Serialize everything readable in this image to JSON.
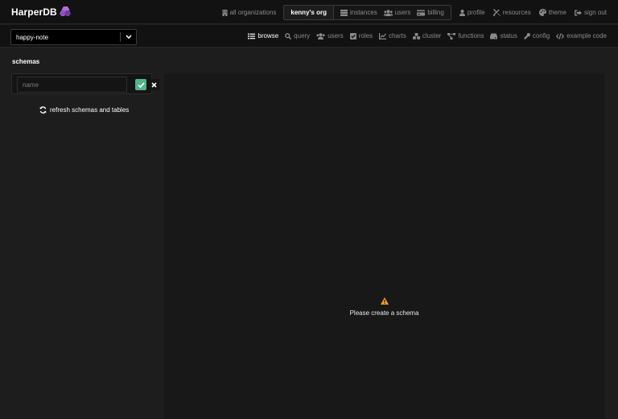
{
  "brand": {
    "name": "HarperDB",
    "logo_icon": "hexagon-logo-icon",
    "logo_colors": [
      "#b36bd6",
      "#6f3aa8"
    ]
  },
  "topnav": {
    "all_orgs": {
      "label": "all organizations",
      "icon": "building-icon"
    },
    "current_org": "kenny's org",
    "org_items": [
      {
        "label": "instances",
        "icon": "server-icon"
      },
      {
        "label": "users",
        "icon": "users-icon"
      },
      {
        "label": "billing",
        "icon": "credit-card-icon"
      }
    ],
    "user_items": [
      {
        "label": "profile",
        "icon": "user-icon"
      },
      {
        "label": "resources",
        "icon": "tools-icon"
      },
      {
        "label": "theme",
        "icon": "palette-icon"
      },
      {
        "label": "sign out",
        "icon": "sign-out-icon"
      }
    ]
  },
  "instance_select": {
    "value": "happy-note",
    "icon": "chevron-down-icon"
  },
  "subnav": {
    "items": [
      {
        "label": "browse",
        "icon": "list-icon",
        "active": true
      },
      {
        "label": "query",
        "icon": "search-icon",
        "active": false
      },
      {
        "label": "users",
        "icon": "users-icon",
        "active": false
      },
      {
        "label": "roles",
        "icon": "check-square-icon",
        "active": false
      },
      {
        "label": "charts",
        "icon": "chart-icon",
        "active": false
      },
      {
        "label": "cluster",
        "icon": "cubes-icon",
        "active": false
      },
      {
        "label": "functions",
        "icon": "project-diagram-icon",
        "active": false
      },
      {
        "label": "status",
        "icon": "hdd-icon",
        "active": false
      },
      {
        "label": "config",
        "icon": "wrench-icon",
        "active": false
      },
      {
        "label": "example code",
        "icon": "code-icon",
        "active": false
      }
    ]
  },
  "schemas": {
    "title": "schemas",
    "input_placeholder": "name",
    "input_value": "",
    "confirm_icon": "check-icon",
    "cancel_icon": "close-icon",
    "refresh_label": "refresh schemas and tables",
    "refresh_icon": "sync-icon"
  },
  "main": {
    "empty_icon": "warning-icon",
    "empty_message": "Please create a schema"
  },
  "colors": {
    "background": "#1d1d1d",
    "bar": "#121212",
    "panel": "#181818",
    "accent_green": "#4fb58a",
    "warning": "#f0a020",
    "muted_text": "#8a8a8a"
  }
}
